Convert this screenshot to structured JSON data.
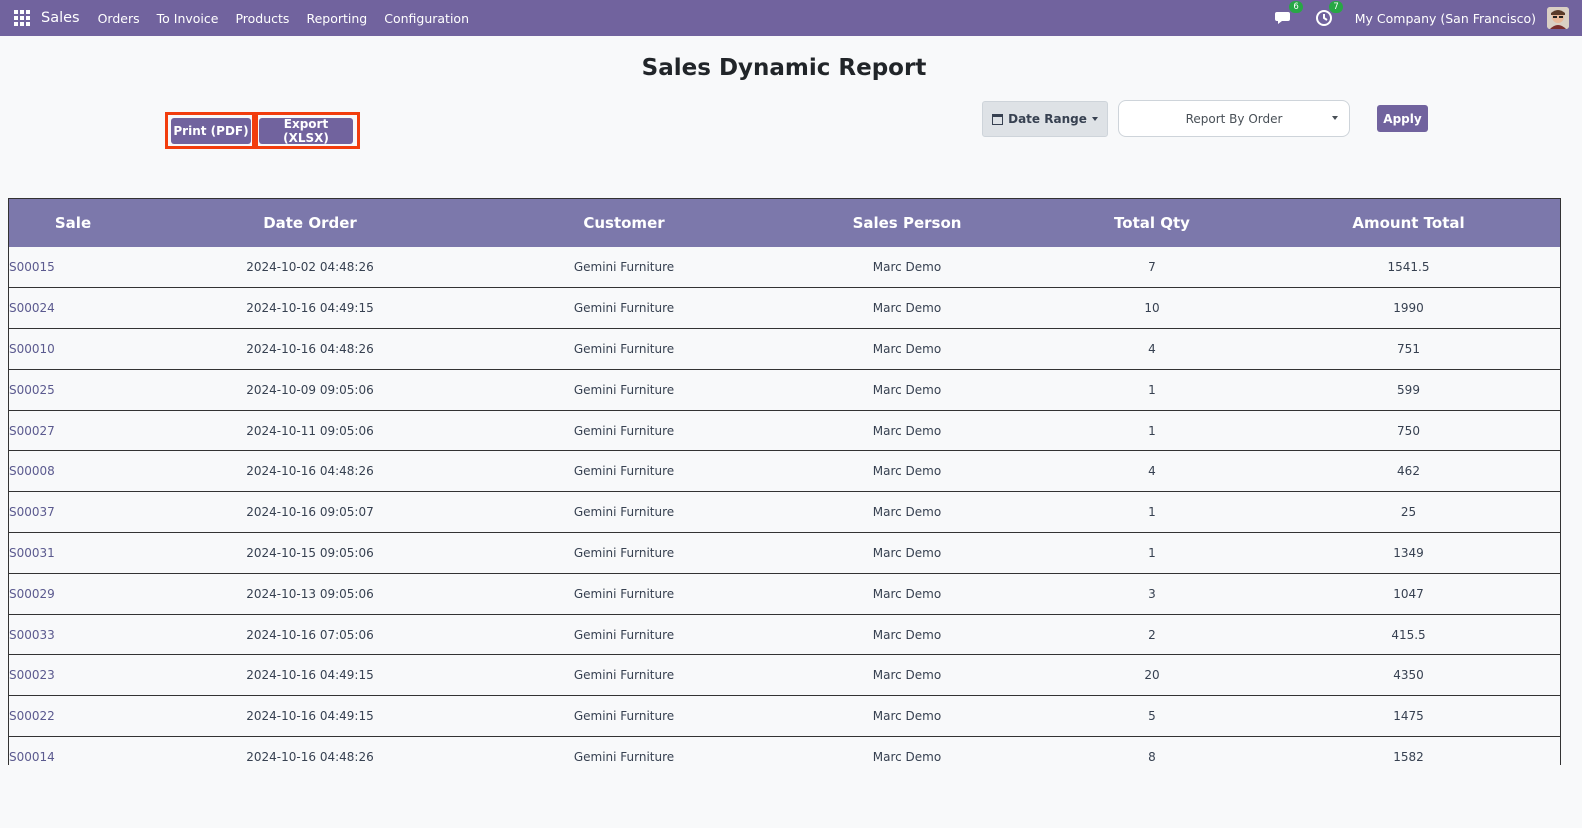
{
  "navbar": {
    "app_name": "Sales",
    "menu": [
      "Orders",
      "To Invoice",
      "Products",
      "Reporting",
      "Configuration"
    ],
    "messages_count": "6",
    "activities_count": "7",
    "company": "My Company (San Francisco)"
  },
  "report": {
    "title": "Sales Dynamic Report",
    "print_label": "Print (PDF)",
    "export_label": "Export (XLSX)",
    "date_range_label": "Date Range",
    "report_by_label": "Report By Order",
    "apply_label": "Apply"
  },
  "table": {
    "headers": [
      "Sale",
      "Date Order",
      "Customer",
      "Sales Person",
      "Total Qty",
      "Amount Total"
    ],
    "rows": [
      [
        "S00015",
        "2024-10-02 04:48:26",
        "Gemini Furniture",
        "Marc Demo",
        "7",
        "1541.5"
      ],
      [
        "S00024",
        "2024-10-16 04:49:15",
        "Gemini Furniture",
        "Marc Demo",
        "10",
        "1990"
      ],
      [
        "S00010",
        "2024-10-16 04:48:26",
        "Gemini Furniture",
        "Marc Demo",
        "4",
        "751"
      ],
      [
        "S00025",
        "2024-10-09 09:05:06",
        "Gemini Furniture",
        "Marc Demo",
        "1",
        "599"
      ],
      [
        "S00027",
        "2024-10-11 09:05:06",
        "Gemini Furniture",
        "Marc Demo",
        "1",
        "750"
      ],
      [
        "S00008",
        "2024-10-16 04:48:26",
        "Gemini Furniture",
        "Marc Demo",
        "4",
        "462"
      ],
      [
        "S00037",
        "2024-10-16 09:05:07",
        "Gemini Furniture",
        "Marc Demo",
        "1",
        "25"
      ],
      [
        "S00031",
        "2024-10-15 09:05:06",
        "Gemini Furniture",
        "Marc Demo",
        "1",
        "1349"
      ],
      [
        "S00029",
        "2024-10-13 09:05:06",
        "Gemini Furniture",
        "Marc Demo",
        "3",
        "1047"
      ],
      [
        "S00033",
        "2024-10-16 07:05:06",
        "Gemini Furniture",
        "Marc Demo",
        "2",
        "415.5"
      ],
      [
        "S00023",
        "2024-10-16 04:49:15",
        "Gemini Furniture",
        "Marc Demo",
        "20",
        "4350"
      ],
      [
        "S00022",
        "2024-10-16 04:49:15",
        "Gemini Furniture",
        "Marc Demo",
        "5",
        "1475"
      ],
      [
        "S00014",
        "2024-10-16 04:48:26",
        "Gemini Furniture",
        "Marc Demo",
        "8",
        "1582"
      ]
    ]
  }
}
